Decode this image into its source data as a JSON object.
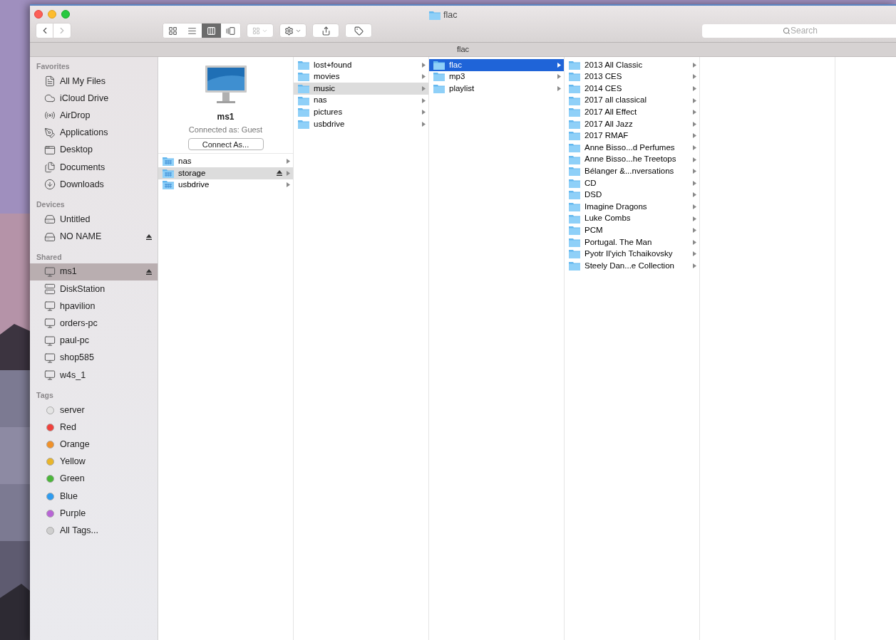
{
  "window": {
    "title": "flac"
  },
  "toolbar": {
    "view_modes": [
      {
        "kind": "icons",
        "selected": false
      },
      {
        "kind": "list",
        "selected": false
      },
      {
        "kind": "columns",
        "selected": true
      },
      {
        "kind": "cover",
        "selected": false
      }
    ],
    "search": {
      "placeholder": "Search"
    }
  },
  "path_bar": "flac",
  "sidebar": [
    {
      "heading": "Favorites",
      "items": [
        {
          "label": "All My Files",
          "kind": "files",
          "selected": false,
          "ejectable": false
        },
        {
          "label": "iCloud Drive",
          "kind": "cloud",
          "selected": false,
          "ejectable": false
        },
        {
          "label": "AirDrop",
          "kind": "airdrop",
          "selected": false,
          "ejectable": false
        },
        {
          "label": "Applications",
          "kind": "apps",
          "selected": false,
          "ejectable": false
        },
        {
          "label": "Desktop",
          "kind": "desktop",
          "selected": false,
          "ejectable": false
        },
        {
          "label": "Documents",
          "kind": "documents",
          "selected": false,
          "ejectable": false
        },
        {
          "label": "Downloads",
          "kind": "downloads",
          "selected": false,
          "ejectable": false
        }
      ]
    },
    {
      "heading": "Devices",
      "items": [
        {
          "label": "Untitled",
          "kind": "disk",
          "selected": false,
          "ejectable": false
        },
        {
          "label": "NO NAME",
          "kind": "drive",
          "selected": false,
          "ejectable": true
        }
      ]
    },
    {
      "heading": "Shared",
      "items": [
        {
          "label": "ms1",
          "kind": "display",
          "selected": true,
          "ejectable": true
        },
        {
          "label": "DiskStation",
          "kind": "nas",
          "selected": false,
          "ejectable": false
        },
        {
          "label": "hpavilion",
          "kind": "pc",
          "selected": false,
          "ejectable": false
        },
        {
          "label": "orders-pc",
          "kind": "pc",
          "selected": false,
          "ejectable": false
        },
        {
          "label": "paul-pc",
          "kind": "pc",
          "selected": false,
          "ejectable": false
        },
        {
          "label": "shop585",
          "kind": "pc",
          "selected": false,
          "ejectable": false
        },
        {
          "label": "w4s_1",
          "kind": "pc",
          "selected": false,
          "ejectable": false
        }
      ]
    },
    {
      "heading": "Tags",
      "items": [
        {
          "label": "server",
          "kind": "tag",
          "color": "#e4e4e4",
          "selected": false,
          "ejectable": false
        },
        {
          "label": "Red",
          "kind": "tag",
          "color": "#f0413c",
          "selected": false,
          "ejectable": false
        },
        {
          "label": "Orange",
          "kind": "tag",
          "color": "#f0912a",
          "selected": false,
          "ejectable": false
        },
        {
          "label": "Yellow",
          "kind": "tag",
          "color": "#e9b52a",
          "selected": false,
          "ejectable": false
        },
        {
          "label": "Green",
          "kind": "tag",
          "color": "#4bb63a",
          "selected": false,
          "ejectable": false
        },
        {
          "label": "Blue",
          "kind": "tag",
          "color": "#2e9cf0",
          "selected": false,
          "ejectable": false
        },
        {
          "label": "Purple",
          "kind": "tag",
          "color": "#b865d6",
          "selected": false,
          "ejectable": false
        },
        {
          "label": "All Tags...",
          "kind": "tag",
          "color": "#cfcfcf",
          "selected": false,
          "ejectable": false
        }
      ]
    }
  ],
  "server": {
    "name": "ms1",
    "status": "Connected as: Guest",
    "button": "Connect As..."
  },
  "columns": [
    {
      "items": [
        {
          "label": "nas",
          "kind": "share",
          "selected": false,
          "ejectable": false
        },
        {
          "label": "storage",
          "kind": "share",
          "selected": true,
          "ejectable": true
        },
        {
          "label": "usbdrive",
          "kind": "share",
          "selected": false,
          "ejectable": false
        }
      ]
    },
    {
      "items": [
        {
          "label": "lost+found",
          "kind": "folder",
          "selected": false,
          "ejectable": false
        },
        {
          "label": "movies",
          "kind": "folder",
          "selected": false,
          "ejectable": false
        },
        {
          "label": "music",
          "kind": "folder",
          "selected": true,
          "ejectable": false
        },
        {
          "label": "nas",
          "kind": "folder",
          "selected": false,
          "ejectable": false
        },
        {
          "label": "pictures",
          "kind": "folder",
          "selected": false,
          "ejectable": false
        },
        {
          "label": "usbdrive",
          "kind": "folder",
          "selected": false,
          "ejectable": false
        }
      ]
    },
    {
      "items": [
        {
          "label": "flac",
          "kind": "folder",
          "selected": true,
          "ejectable": false
        },
        {
          "label": "mp3",
          "kind": "folder",
          "selected": false,
          "ejectable": false
        },
        {
          "label": "playlist",
          "kind": "folder",
          "selected": false,
          "ejectable": false
        }
      ]
    },
    {
      "items": [
        {
          "label": "2013 All Classic",
          "kind": "folder",
          "selected": false,
          "ejectable": false
        },
        {
          "label": "2013 CES",
          "kind": "folder",
          "selected": false,
          "ejectable": false
        },
        {
          "label": "2014 CES",
          "kind": "folder",
          "selected": false,
          "ejectable": false
        },
        {
          "label": "2017 all classical",
          "kind": "folder",
          "selected": false,
          "ejectable": false
        },
        {
          "label": "2017 All Effect",
          "kind": "folder",
          "selected": false,
          "ejectable": false
        },
        {
          "label": "2017 All Jazz",
          "kind": "folder",
          "selected": false,
          "ejectable": false
        },
        {
          "label": "2017 RMAF",
          "kind": "folder",
          "selected": false,
          "ejectable": false
        },
        {
          "label": "Anne Bisso...d Perfumes",
          "kind": "folder",
          "selected": false,
          "ejectable": false
        },
        {
          "label": "Anne Bisso...he Treetops",
          "kind": "folder",
          "selected": false,
          "ejectable": false
        },
        {
          "label": "Bélanger &...nversations",
          "kind": "folder",
          "selected": false,
          "ejectable": false
        },
        {
          "label": "CD",
          "kind": "folder",
          "selected": false,
          "ejectable": false
        },
        {
          "label": "DSD",
          "kind": "folder",
          "selected": false,
          "ejectable": false
        },
        {
          "label": "Imagine Dragons",
          "kind": "folder",
          "selected": false,
          "ejectable": false
        },
        {
          "label": "Luke Combs",
          "kind": "folder",
          "selected": false,
          "ejectable": false
        },
        {
          "label": "PCM",
          "kind": "folder",
          "selected": false,
          "ejectable": false
        },
        {
          "label": "Portugal. The Man",
          "kind": "folder",
          "selected": false,
          "ejectable": false
        },
        {
          "label": "Pyotr Il'yich Tchaikovsky",
          "kind": "folder",
          "selected": false,
          "ejectable": false
        },
        {
          "label": "Steely Dan...e Collection",
          "kind": "folder",
          "selected": false,
          "ejectable": false
        }
      ]
    }
  ]
}
